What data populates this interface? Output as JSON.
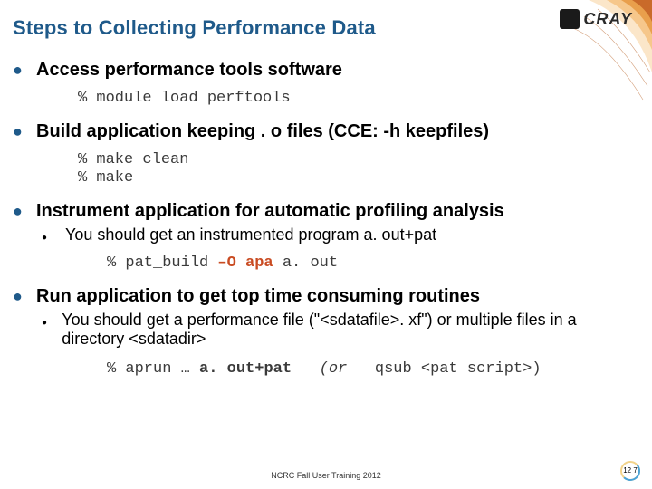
{
  "logo_text": "CRAY",
  "title": "Steps to Collecting Performance Data",
  "items": [
    {
      "heading": "Access performance tools software",
      "code": "% module load perftools"
    },
    {
      "heading": "Build application  keeping . o files (CCE: -h keepfiles)",
      "code": "% make clean\n% make"
    },
    {
      "heading": "Instrument application for automatic profiling analysis",
      "sub": {
        "text": "You should get an instrumented program a. out+pat",
        "code_prefix": "% pat_build ",
        "code_flag": "–O apa",
        "code_rest": " a. out"
      }
    },
    {
      "heading": "Run application to get top time consuming routines",
      "sub": {
        "text": "You should get a performance file (\"<sdatafile>. xf\")  or multiple files in a directory <sdatadir>",
        "code_prefix": "% aprun … ",
        "code_bold": "a. out+pat",
        "code_ital_open": "   (or   ",
        "code_tail": "qsub <pat script>)"
      }
    }
  ],
  "footer": "NCRC Fall User Training 2012",
  "page_number": "12\n7"
}
